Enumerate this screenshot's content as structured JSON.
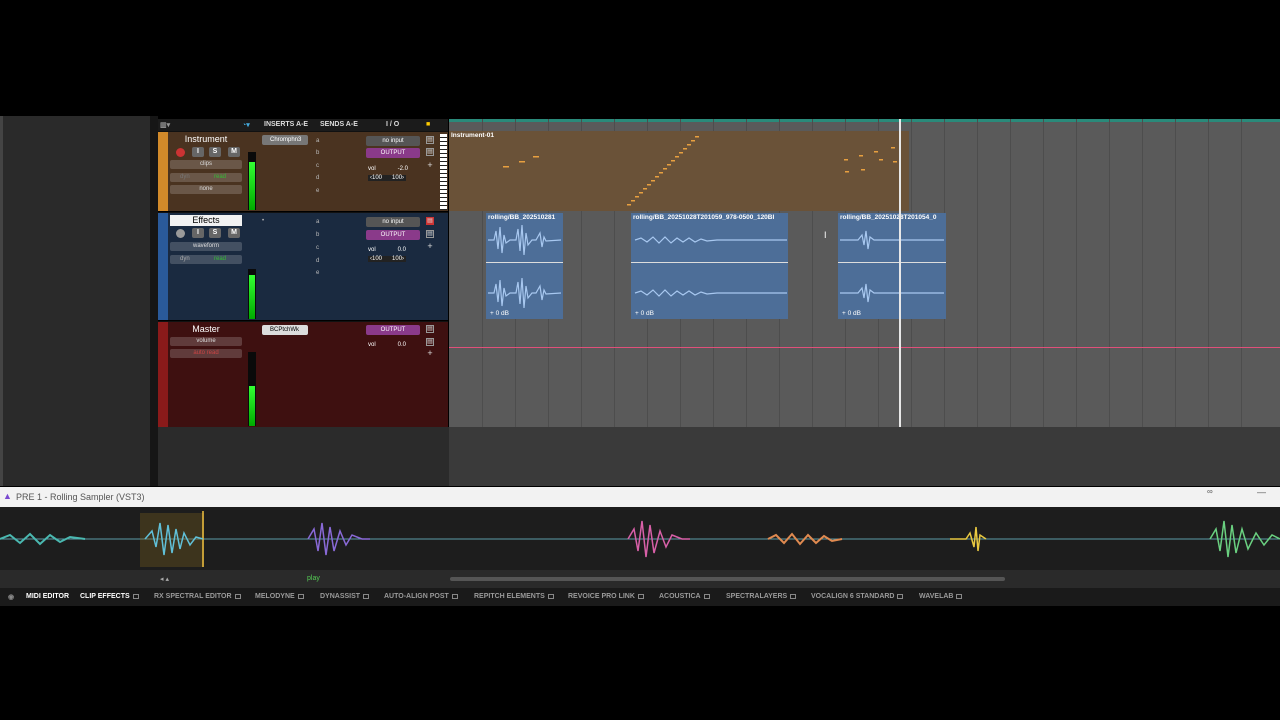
{
  "header": {
    "inserts": "INSERTS A-E",
    "sends": "SENDS A-E",
    "io": "I / O"
  },
  "tracks": [
    {
      "name": "Instrument",
      "buttons": [
        "I",
        "S",
        "M"
      ],
      "view": "clips",
      "automation": "read",
      "automation_label": "dyn",
      "group": "none",
      "insert": "Chromphn3",
      "send_letters": [
        "a",
        "b",
        "c",
        "d",
        "e"
      ],
      "input": "no input",
      "output": "OUTPUT",
      "vol_label": "vol",
      "vol_value": "-2.0",
      "pan_left": "‹100",
      "pan_right": "100›"
    },
    {
      "name": "Effects",
      "buttons": [
        "I",
        "S",
        "M"
      ],
      "view": "waveform",
      "automation": "read",
      "automation_label": "dyn",
      "send_letters": [
        "a",
        "b",
        "c",
        "d",
        "e"
      ],
      "input": "no input",
      "output": "OUTPUT",
      "vol_label": "vol",
      "vol_value": "0.0",
      "pan_left": "‹100",
      "pan_right": "100›"
    },
    {
      "name": "Master",
      "view": "volume",
      "automation": "auto read",
      "insert": "BCPtchWk",
      "output": "OUTPUT",
      "vol_label": "vol",
      "vol_value": "0.0"
    }
  ],
  "clips": {
    "midi": "Instrument-01",
    "audio": [
      {
        "title": "rolling/BB_202510281",
        "gain": "+ 0 dB"
      },
      {
        "title": "rolling/BB_20251028T201059_978-0500_120BI",
        "gain": "+ 0 dB"
      },
      {
        "title": "rolling/BB_20251028T201054_0",
        "gain": "+ 0 dB"
      }
    ]
  },
  "plugin": {
    "title": "PRE 1 - Rolling Sampler (VST3)",
    "play_label": "play",
    "minimize": "—"
  },
  "tabs": [
    "MIDI EDITOR",
    "CLIP EFFECTS",
    "RX SPECTRAL EDITOR",
    "MELODYNE",
    "DYNASSIST",
    "AUTO-ALIGN POST",
    "REPITCH ELEMENTS",
    "REVOICE PRO LINK",
    "ACOUSTICA",
    "SPECTRALAYERS",
    "VOCALIGN 6 STANDARD",
    "WAVELAB"
  ],
  "colors": {
    "instrument_track": "#4a3320",
    "effects_track": "#1a2a40",
    "master_track": "#3e1010",
    "clip_blue": "#5d7ea8",
    "playhead": "#e8e8e8",
    "master_line": "#e0507a"
  }
}
